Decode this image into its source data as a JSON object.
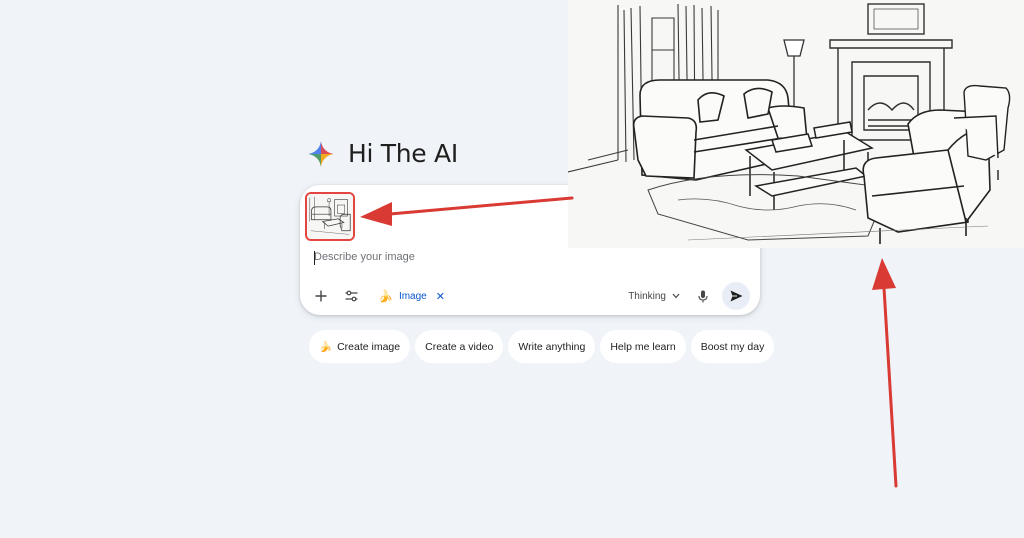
{
  "greeting": {
    "text": "Hi The AI",
    "icon": "gemini-spark-icon"
  },
  "composer": {
    "attachment": {
      "icon": "image-thumbnail",
      "border_color": "#e2463f"
    },
    "placeholder": "Describe your image",
    "tools": {
      "add_icon": "plus-icon",
      "tools_icon": "sliders-icon",
      "active_tool": {
        "icon": "banana-icon",
        "icon_glyph": "🍌",
        "label": "Image",
        "close_glyph": "✕"
      }
    },
    "model": {
      "label": "Thinking",
      "icon": "chevron-down-icon"
    },
    "mic_icon": "mic-icon",
    "send_icon": "send-icon"
  },
  "suggestions": [
    {
      "label": "Create image",
      "icon": "banana-icon",
      "icon_glyph": "🍌"
    },
    {
      "label": "Create a video"
    },
    {
      "label": "Write anything"
    },
    {
      "label": "Help me learn"
    },
    {
      "label": "Boost my day"
    }
  ],
  "colors": {
    "background": "#f0f4f9",
    "accent": "#0b57d0",
    "annotation_arrow": "#d93a33"
  }
}
